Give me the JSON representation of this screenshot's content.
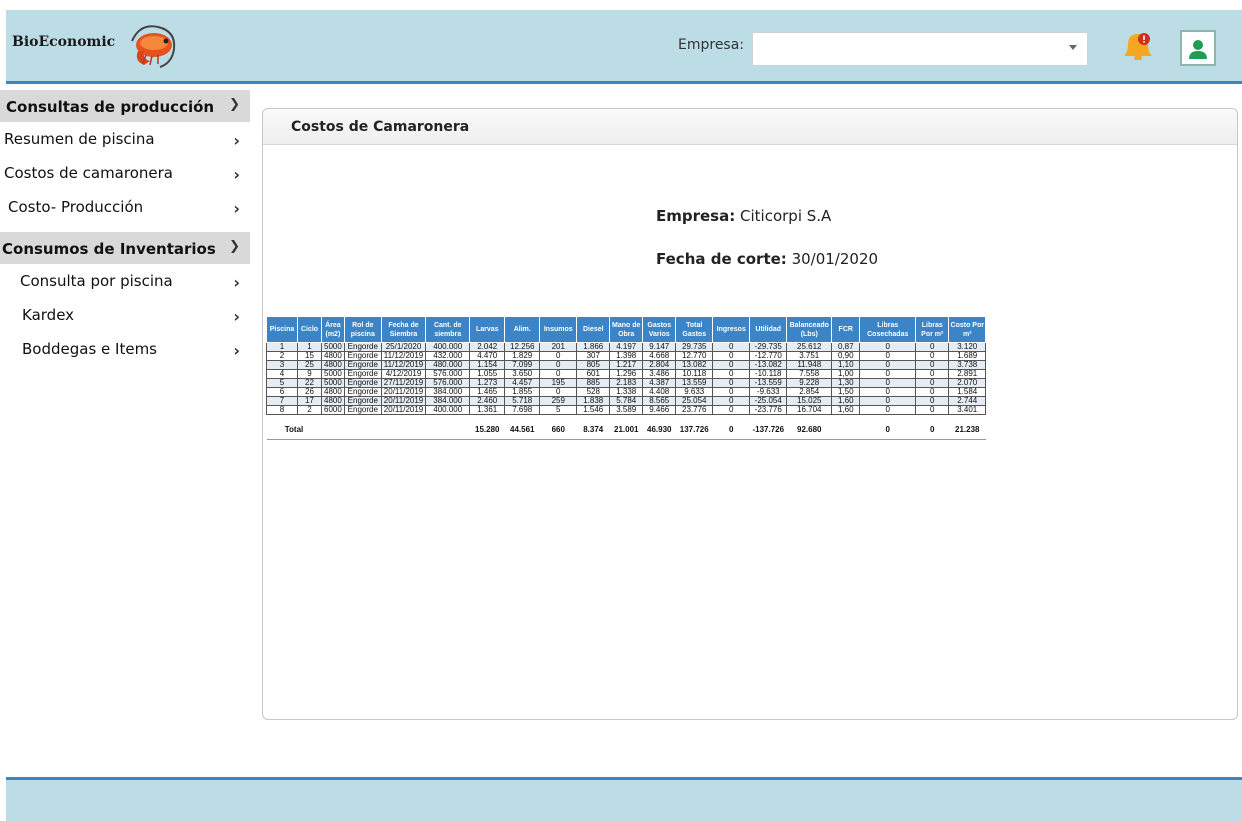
{
  "header": {
    "brand": "BioEconomic",
    "empresa_label": "Empresa:",
    "empresa_value": "",
    "icons": {
      "logo": "shrimp-logo",
      "notifications": "bell-icon",
      "user": "user-icon"
    }
  },
  "sidebar": {
    "groups": [
      {
        "label": "Consultas de producción",
        "items": [
          "Resumen de piscina",
          "Costos de camaronera",
          "Costo- Producción"
        ]
      },
      {
        "label": "Consumos de Inventarios",
        "items": [
          "Consulta por piscina",
          "Kardex",
          "Boddegas e Items"
        ]
      }
    ]
  },
  "panel": {
    "title": "Costos de Camaronera",
    "empresa_label": "Empresa:",
    "empresa_value": "Citicorpi S.A",
    "fecha_label": "Fecha de corte:",
    "fecha_value": "30/01/2020"
  },
  "table": {
    "headers": [
      "Piscina",
      "Ciclo",
      "Área (m2)",
      "Rol de piscina",
      "Fecha de Siembra",
      "Cant. de siembra",
      "Larvas",
      "Alim.",
      "Insumos",
      "Diesel",
      "Mano de Obra",
      "Gastos Varios",
      "Total Gastos",
      "Ingresos",
      "Utilidad",
      "Balanceado (Lbs)",
      "FCR",
      "Libras Cosechadas",
      "Libras Por m²",
      "Costo Por m²"
    ],
    "rows": [
      [
        "1",
        "1",
        "5000",
        "Engorde",
        "25/1/2020",
        "400.000",
        "2.042",
        "12.256",
        "201",
        "1.866",
        "4.197",
        "9.147",
        "29.735",
        "0",
        "-29.735",
        "25.612",
        "0,87",
        "0",
        "0",
        "3.120"
      ],
      [
        "2",
        "15",
        "4800",
        "Engorde",
        "11/12/2019",
        "432.000",
        "4.470",
        "1.829",
        "0",
        "307",
        "1.398",
        "4.668",
        "12.770",
        "0",
        "-12.770",
        "3.751",
        "0,90",
        "0",
        "0",
        "1.689"
      ],
      [
        "3",
        "25",
        "4800",
        "Engorde",
        "11/12/2019",
        "480.000",
        "1.154",
        "7.099",
        "0",
        "805",
        "1.217",
        "2.804",
        "13.082",
        "0",
        "-13.082",
        "11.948",
        "1,10",
        "0",
        "0",
        "3.738"
      ],
      [
        "4",
        "9",
        "5000",
        "Engorde",
        "4/12/2019",
        "576.000",
        "1.055",
        "3.650",
        "0",
        "601",
        "1.296",
        "3.486",
        "10.118",
        "0",
        "-10.118",
        "7.558",
        "1,00",
        "0",
        "0",
        "2.891"
      ],
      [
        "5",
        "22",
        "5000",
        "Engorde",
        "27/11/2019",
        "576.000",
        "1.273",
        "4.457",
        "195",
        "885",
        "2.183",
        "4.387",
        "13.559",
        "0",
        "-13.559",
        "9.228",
        "1,30",
        "0",
        "0",
        "2.070"
      ],
      [
        "6",
        "26",
        "4800",
        "Engorde",
        "20/11/2019",
        "384.000",
        "1.465",
        "1.855",
        "0",
        "528",
        "1.338",
        "4.408",
        "9.633",
        "0",
        "-9.633",
        "2.854",
        "1,50",
        "0",
        "0",
        "1.584"
      ],
      [
        "7",
        "17",
        "4800",
        "Engorde",
        "20/11/2019",
        "384.000",
        "2.460",
        "5.718",
        "259",
        "1.838",
        "5.784",
        "8.565",
        "25.054",
        "0",
        "-25.054",
        "15.025",
        "1,60",
        "0",
        "0",
        "2.744"
      ],
      [
        "8",
        "2",
        "6000",
        "Engorde",
        "20/11/2019",
        "400.000",
        "1.361",
        "7.698",
        "5",
        "1.546",
        "3.589",
        "9.466",
        "23.776",
        "0",
        "-23.776",
        "16.704",
        "1,60",
        "0",
        "0",
        "3.401"
      ]
    ],
    "total_label": "Total",
    "totals": [
      "15.280",
      "44.561",
      "660",
      "8.374",
      "21.001",
      "46.930",
      "137.726",
      "0",
      "-137.726",
      "92.680",
      "",
      "0",
      "0",
      "21.238"
    ]
  }
}
